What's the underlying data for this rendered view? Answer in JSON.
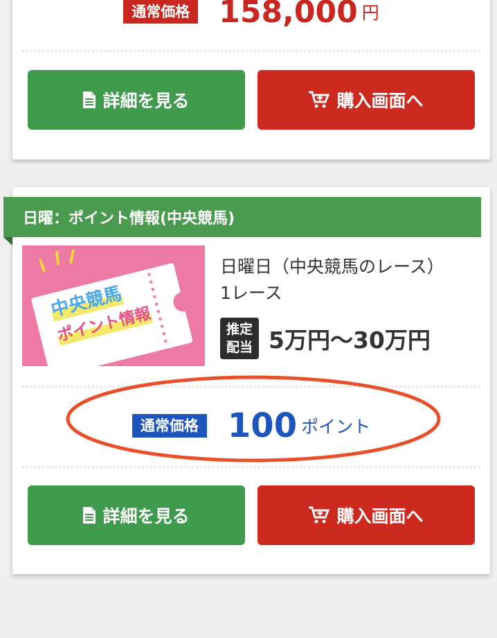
{
  "card1": {
    "price_badge": "通常価格",
    "price_value": "158,000",
    "price_unit": "円",
    "detail_button": "詳細を見る",
    "buy_button": "購入画面へ"
  },
  "card2": {
    "ribbon": "日曜：ポイント情報(中央競馬)",
    "thumbnail": {
      "line1": "中央競馬",
      "line2": "ポイント情報"
    },
    "title_line1": "日曜日（中央競馬のレース）",
    "title_line2": "1レース",
    "payout_badge_line1": "推定",
    "payout_badge_line2": "配当",
    "payout_value": "5万円〜30万円",
    "price_badge": "通常価格",
    "price_value": "100",
    "price_unit": "ポイント",
    "detail_button": "詳細を見る",
    "buy_button": "購入画面へ"
  },
  "colors": {
    "green": "#3f9a4e",
    "red": "#cc2a1f",
    "blue": "#1e55bd",
    "highlight_circle": "#e8502a"
  },
  "icons": [
    "document-icon",
    "cart-icon"
  ]
}
